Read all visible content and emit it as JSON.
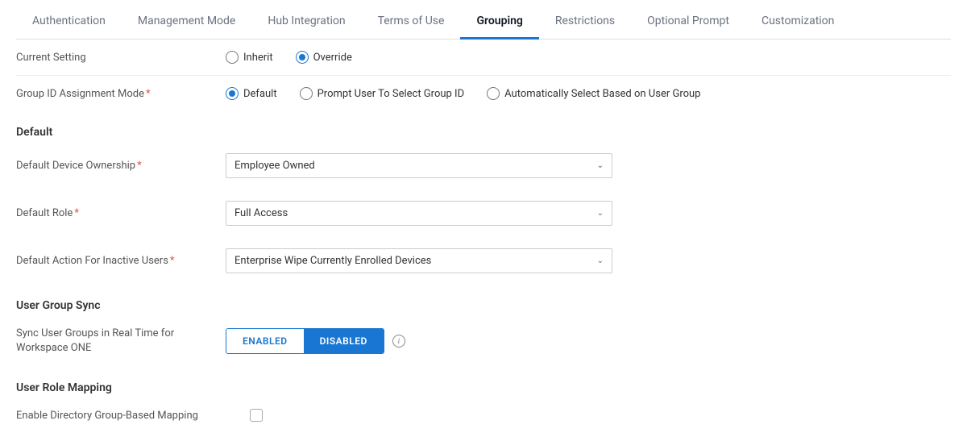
{
  "tabs": [
    {
      "label": "Authentication",
      "active": false
    },
    {
      "label": "Management Mode",
      "active": false
    },
    {
      "label": "Hub Integration",
      "active": false
    },
    {
      "label": "Terms of Use",
      "active": false
    },
    {
      "label": "Grouping",
      "active": true
    },
    {
      "label": "Restrictions",
      "active": false
    },
    {
      "label": "Optional Prompt",
      "active": false
    },
    {
      "label": "Customization",
      "active": false
    }
  ],
  "currentSetting": {
    "label": "Current Setting",
    "options": [
      "Inherit",
      "Override"
    ],
    "selected": "Override"
  },
  "groupIdMode": {
    "label": "Group ID Assignment Mode",
    "required": true,
    "options": [
      "Default",
      "Prompt User To Select Group ID",
      "Automatically Select Based on User Group"
    ],
    "selected": "Default"
  },
  "sections": {
    "default": {
      "title": "Default",
      "fields": {
        "ownership": {
          "label": "Default Device Ownership",
          "required": true,
          "value": "Employee Owned"
        },
        "role": {
          "label": "Default Role",
          "required": true,
          "value": "Full Access"
        },
        "inactive": {
          "label": "Default Action For Inactive Users",
          "required": true,
          "value": "Enterprise Wipe Currently Enrolled Devices"
        }
      }
    },
    "userGroupSync": {
      "title": "User Group Sync",
      "field": {
        "label": "Sync User Groups in Real Time for Workspace ONE",
        "options": [
          "ENABLED",
          "DISABLED"
        ],
        "selected": "DISABLED"
      }
    },
    "userRoleMapping": {
      "title": "User Role Mapping",
      "field": {
        "label": "Enable Directory Group-Based Mapping",
        "checked": false
      }
    }
  }
}
